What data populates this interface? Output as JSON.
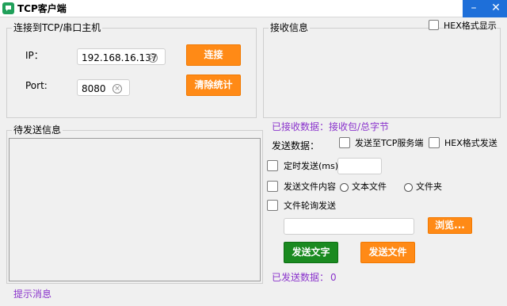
{
  "window": {
    "title": "TCP客户端",
    "minimize_glyph": "–",
    "close_glyph": "✕",
    "icon": "app-logo-icon"
  },
  "connect_group": {
    "title": "连接到TCP/串口主机",
    "ip_label": "IP：",
    "ip_value": "192.168.16.137",
    "port_label": "Port:",
    "port_value": "8080",
    "clear_glyph": "×",
    "connect_button": "连接",
    "clear_stats_button": "清除统计"
  },
  "receive_group": {
    "title": "接收信息",
    "hex_display_label": "HEX格式显示",
    "hex_display_checked": false
  },
  "send_group": {
    "title": "待发送信息"
  },
  "stats": {
    "received_label": "已接收数据：接收包/总字节",
    "sent_label": "已发送数据：",
    "sent_value": "0",
    "color": "#8a33cc"
  },
  "send_options": {
    "send_data_label": "发送数据：",
    "to_tcp_server_label": "发送至TCP服务端",
    "hex_send_label": "HEX格式发送",
    "timed_send_label": "定时发送(ms)",
    "timed_send_value": "",
    "send_file_content_label": "发送文件内容",
    "text_file_label": "文本文件",
    "folder_label": "文件夹",
    "file_poll_label": "文件轮询发送",
    "file_path_value": "",
    "browse_button": "浏览..."
  },
  "actions": {
    "send_text_button": "发送文字",
    "send_file_button": "发送文件"
  },
  "status_bar": {
    "message": "提示消息"
  },
  "colors": {
    "accent_orange": "#ff8a16",
    "send_green": "#1a8a20",
    "titlebar_button_blue": "#1e6fd9"
  }
}
